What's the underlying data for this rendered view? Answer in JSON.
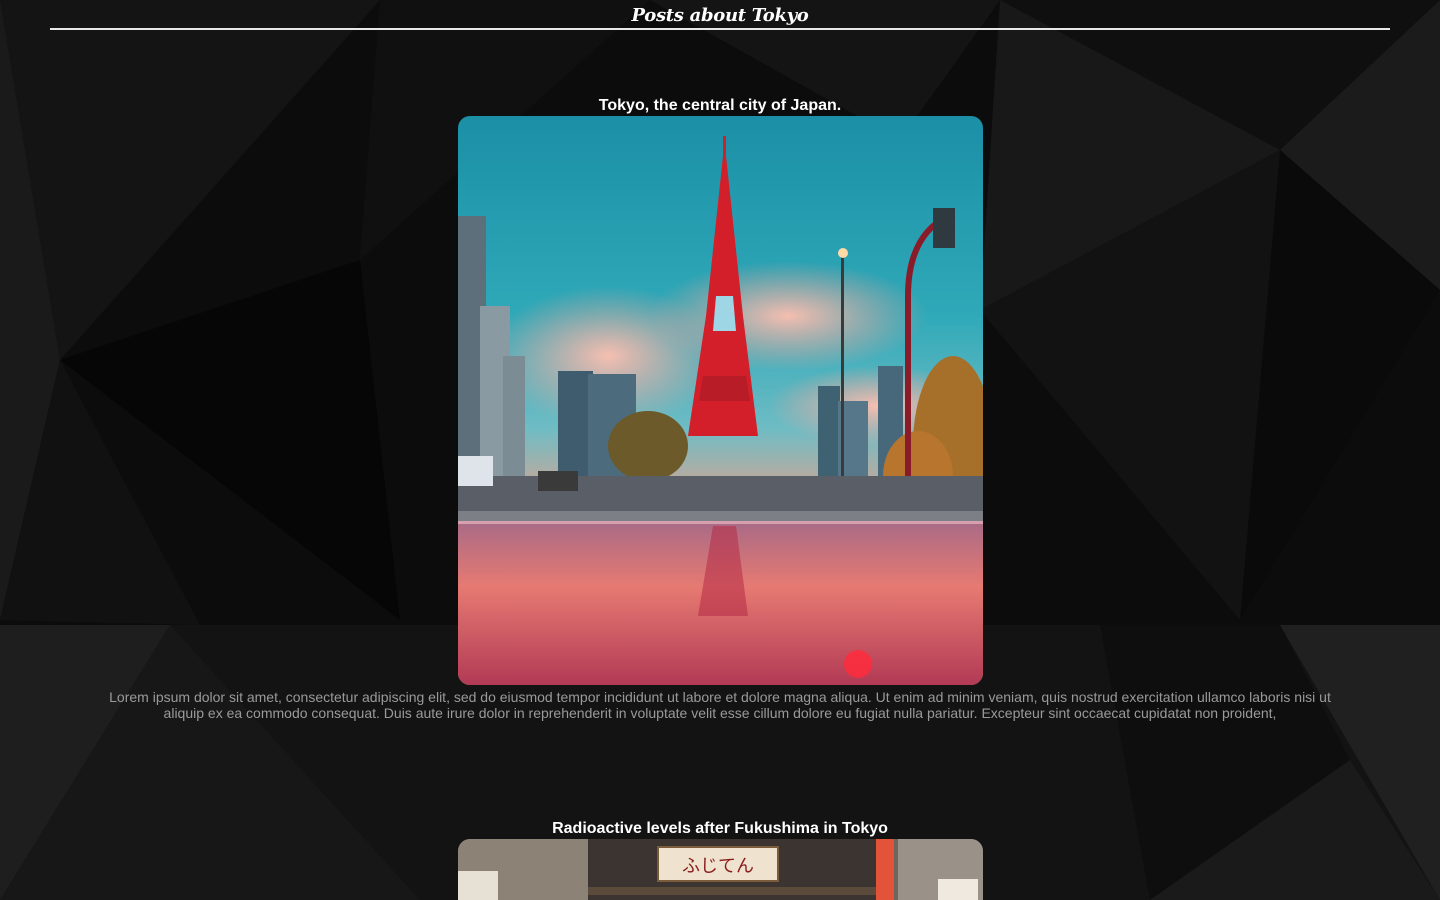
{
  "header": {
    "title": "Posts about Tokyo"
  },
  "posts": [
    {
      "title": "Tokyo, the central city of Japan.",
      "image_icon": "tokyo-tower-photo",
      "text": "Lorem ipsum dolor sit amet, consectetur adipiscing elit, sed do eiusmod tempor incididunt ut labore et dolore magna aliqua. Ut enim ad minim veniam, quis nostrud exercitation ullamco laboris nisi ut aliquip ex ea commodo consequat. Duis aute irure dolor in reprehenderit in voluptate velit esse cillum dolore eu fugiat nulla pariatur. Excepteur sint occaecat cupidatat non proident,"
    },
    {
      "title": "Radioactive levels after Fukushima in Tokyo",
      "image_icon": "street-shop-photo",
      "sign_text": "ふじてん"
    }
  ],
  "colors": {
    "background": "#0b0b0b",
    "header_rule": "#e8e8e8",
    "body_text": "#9a9a9a"
  }
}
